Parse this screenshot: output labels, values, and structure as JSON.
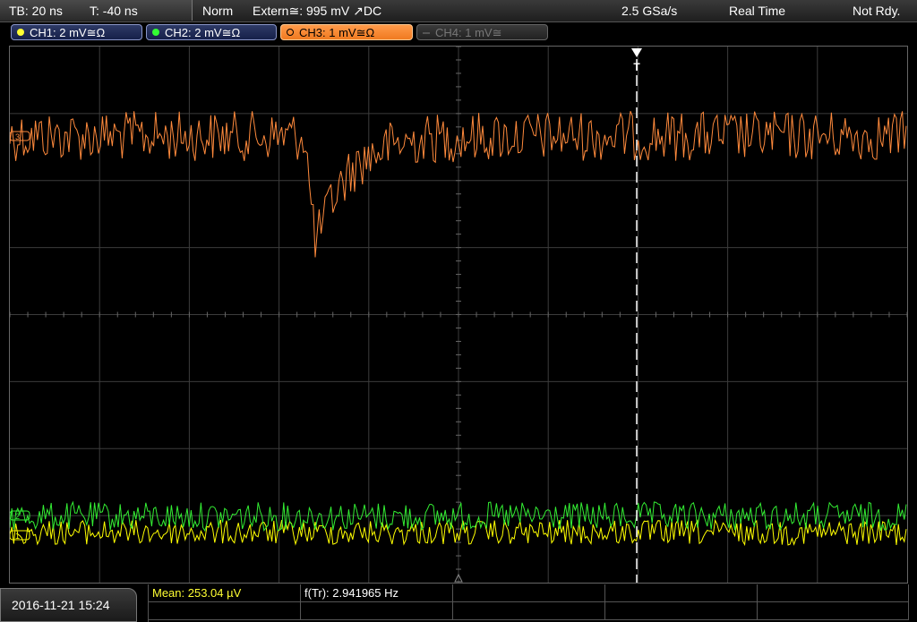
{
  "status": {
    "timebase": "TB: 20 ns",
    "trigger_time": "T: -40 ns",
    "mode": "Norm",
    "trigger": "Extern≅: 995 mV ↗DC",
    "sample_rate": "2.5 GSa/s",
    "acq_mode": "Real Time",
    "state": "Not Rdy."
  },
  "channels": [
    {
      "label": "CH1: 2 mV≅Ω",
      "color": "#ffff33",
      "state": "on"
    },
    {
      "label": "CH2: 2 mV≅Ω",
      "color": "#33ff33",
      "state": "on"
    },
    {
      "label": "CH3: 1 mV≅Ω",
      "color": "#ff8c33",
      "state": "active"
    },
    {
      "label": "CH4: 1 mV≅",
      "color": "#777777",
      "state": "off"
    }
  ],
  "markers": {
    "trigger_label": "T",
    "ch3_marker": "3",
    "ch2_marker": "2",
    "ch1_marker": "1"
  },
  "waveform_colors": {
    "ch1": "#ffff00",
    "ch2": "#33ee33",
    "ch3": "#ff8a3c",
    "grid": "#3c3c3c",
    "trigger_line": "#ffffff"
  },
  "measurements": {
    "mean": "Mean: 253.04 µV",
    "freq": "f(Tr): 2.941965 Hz"
  },
  "datetime": "2016-11-21 15:24"
}
